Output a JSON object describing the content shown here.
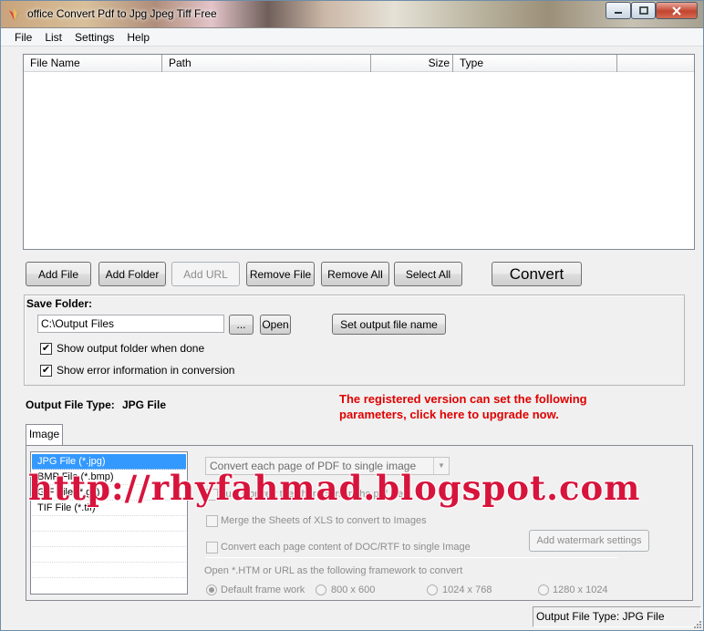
{
  "window": {
    "title": "office Convert Pdf to Jpg Jpeg Tiff Free",
    "controls": {
      "minimize": "minimize",
      "maximize": "maximize",
      "close": "close"
    }
  },
  "menu": [
    "File",
    "List",
    "Settings",
    "Help"
  ],
  "list_columns": [
    "File Name",
    "Path",
    "Size",
    "Type"
  ],
  "buttons": {
    "add_file": "Add File",
    "add_folder": "Add Folder",
    "add_url": "Add URL",
    "remove_file": "Remove File",
    "remove_all": "Remove All",
    "select_all": "Select All",
    "convert": "Convert"
  },
  "save_folder": {
    "label": "Save Folder:",
    "path": "C:\\Output Files",
    "browse": "...",
    "open": "Open",
    "set_output_name": "Set output file name",
    "checkboxes": [
      {
        "label": "Show output folder when done",
        "checked": true
      },
      {
        "label": "Show error information in conversion",
        "checked": true
      }
    ]
  },
  "output_type": {
    "label": "Output File Type:",
    "value": "JPG File"
  },
  "upgrade_notice": "The registered version can set the following parameters, click here to upgrade now.",
  "tabs": [
    "Image"
  ],
  "file_types": [
    "JPG File  (*.jpg)",
    "BMP File  (*.bmp)",
    "GIF File  (*.gif)",
    "TIF File  (*.tif)"
  ],
  "options": {
    "pdf_mode": "Convert each page of PDF to single image",
    "just_convert_chars": "Just Convert the characters in the pdf file",
    "merge_xls": "Merge the Sheets of XLS to convert to Images",
    "convert_doc_rtf": "Convert each page content of DOC/RTF to single Image",
    "watermark_button": "Add watermark settings",
    "framework_label": "Open *.HTM or URL as the following framework to convert",
    "frameworks": [
      "Default frame work",
      "800 x 600",
      "1024 x 768",
      "1280 x 1024"
    ]
  },
  "status": "Output File Type:  JPG File",
  "watermark_text": "http://rhyfahmad.blogspot.com"
}
